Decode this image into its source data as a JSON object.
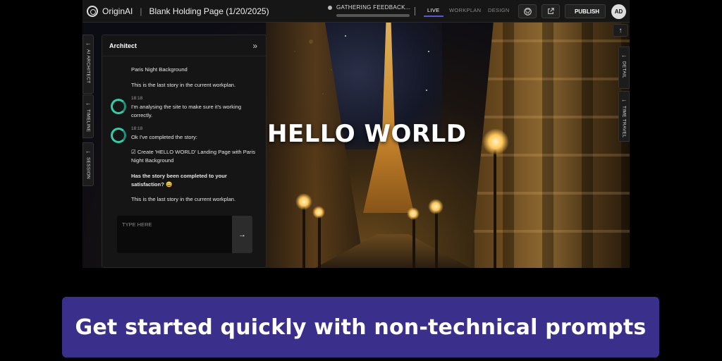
{
  "app": {
    "logo_text": "OriginAI",
    "separator": "|",
    "page_title": "Blank Holding Page (1/20/2025)",
    "status_text": "GATHERING FEEDBACK...",
    "tabs": [
      {
        "label": "LIVE",
        "active": true
      },
      {
        "label": "WORKPLAN",
        "active": false
      },
      {
        "label": "DESIGN",
        "active": false
      }
    ],
    "publish_label": "PUBLISH",
    "avatar_initials": "AD",
    "icons": [
      "github-icon",
      "external-link-icon",
      "rocket-icon"
    ]
  },
  "side_tabs": {
    "left": [
      "AI ARCHITECT",
      "TIMELINE",
      "SESSION"
    ],
    "right": [
      "DETAIL",
      "TIME TRAVEL"
    ]
  },
  "preview": {
    "headline": "HELLO WORLD"
  },
  "architect": {
    "title": "Architect",
    "messages": {
      "m0": "Paris Night Background",
      "m1": "This is the last story in the current workplan.",
      "t2": "18:18",
      "m2a": "I'm analysing the site to make sure it's working",
      "m2b": "correctly.",
      "t3": "18:18",
      "m3": "Ok I've completed the story:",
      "m4a": "☑ Create 'HELLO WORLD' Landing Page with Paris",
      "m4b": "Night Background",
      "m5a": "Has the story been completed to your",
      "m5b": "satisfaction? 😀",
      "m6": "This is the last story in the current workplan."
    },
    "input_placeholder": "TYPE HERE"
  },
  "banner": {
    "text": "Get started quickly with non-technical prompts",
    "color": "#3b2f8c"
  },
  "colors": {
    "accent": "#5b57d9",
    "bot_avatar": "#2fd0a8"
  }
}
